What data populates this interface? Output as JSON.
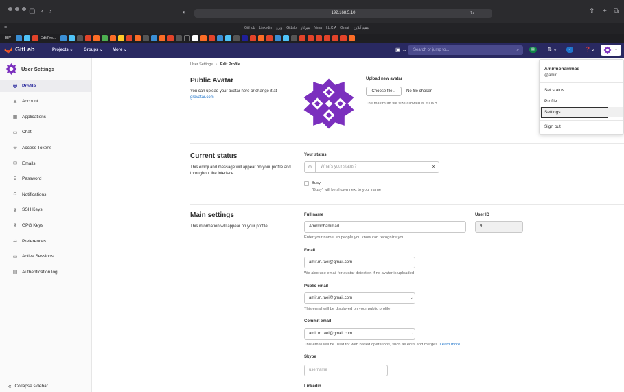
{
  "browser": {
    "url": "192.168.5.10",
    "favorites": [
      "GitHub",
      "Linkedin",
      "ویرو",
      "GitLab",
      "میزکار",
      "Nima",
      "I.L.C.A",
      "Gmail",
      "مفید آنلاین"
    ],
    "tab_label": "Edit Pro...",
    "tab_prefix": "BIY"
  },
  "navbar": {
    "brand": "GitLab",
    "projects": "Projects ⌄",
    "groups": "Groups ⌄",
    "more": "More ⌄",
    "search_placeholder": "Search or jump to...",
    "mr_count": "",
    "issues_label": "",
    "todo_count": ""
  },
  "sidebar": {
    "title": "User Settings",
    "items": [
      {
        "label": "Profile",
        "icon": "profile-icon"
      },
      {
        "label": "Account",
        "icon": "account-icon"
      },
      {
        "label": "Applications",
        "icon": "applications-icon"
      },
      {
        "label": "Chat",
        "icon": "chat-icon"
      },
      {
        "label": "Access Tokens",
        "icon": "token-icon"
      },
      {
        "label": "Emails",
        "icon": "mail-icon"
      },
      {
        "label": "Password",
        "icon": "lock-icon"
      },
      {
        "label": "Notifications",
        "icon": "bell-icon"
      },
      {
        "label": "SSH Keys",
        "icon": "key-icon"
      },
      {
        "label": "GPG Keys",
        "icon": "key-icon"
      },
      {
        "label": "Preferences",
        "icon": "preferences-icon"
      },
      {
        "label": "Active Sessions",
        "icon": "monitor-icon"
      },
      {
        "label": "Authentication log",
        "icon": "log-icon"
      }
    ],
    "collapse": "Collapse sidebar"
  },
  "breadcrumb": {
    "parent": "User Settings",
    "current": "Edit Profile"
  },
  "avatar_section": {
    "title": "Public Avatar",
    "desc_prefix": "You can upload your avatar here or change it at ",
    "desc_link": "gravatar.com",
    "upload_label": "Upload new avatar",
    "choose_file": "Choose file...",
    "no_file": "No file chosen",
    "max_size": "The maximum file size allowed is 200KB."
  },
  "status_section": {
    "title": "Current status",
    "desc": "This emoji and message will appear on your profile and throughout the interface.",
    "your_status": "Your status",
    "placeholder": "What's your status?",
    "clear": "×",
    "busy": "Busy",
    "busy_help": "\"Busy\" will be shown next to your name"
  },
  "main_section": {
    "title": "Main settings",
    "desc": "This information will appear on your profile",
    "full_name_label": "Full name",
    "full_name_value": "Amirmohammad",
    "full_name_help": "Enter your name, so people you know can recognize you",
    "user_id_label": "User ID",
    "user_id_value": "9",
    "email_label": "Email",
    "email_value": "amir.m.raei@gmail.com",
    "email_help": "We also use email for avatar detection if no avatar is uploaded",
    "public_email_label": "Public email",
    "public_email_value": "amir.m.raei@gmail.com",
    "public_email_help": "This email will be displayed on your public profile",
    "commit_email_label": "Commit email",
    "commit_email_value": "amir.m.raei@gmail.com",
    "commit_email_help": "This email will be used for web based operations, such as edits and merges.",
    "commit_email_link": "Learn more",
    "skype_label": "Skype",
    "skype_placeholder": "username",
    "linkedin_label": "Linkedin"
  },
  "dropdown": {
    "name": "Amirmohammad",
    "username": "@amir",
    "set_status": "Set status",
    "profile": "Profile",
    "settings": "Settings",
    "sign_out": "Sign out"
  },
  "colors": {
    "navbar": "#292961",
    "active_link": "#1f1f99",
    "link": "#1f75cb",
    "avatar": "#7b2fbe"
  }
}
